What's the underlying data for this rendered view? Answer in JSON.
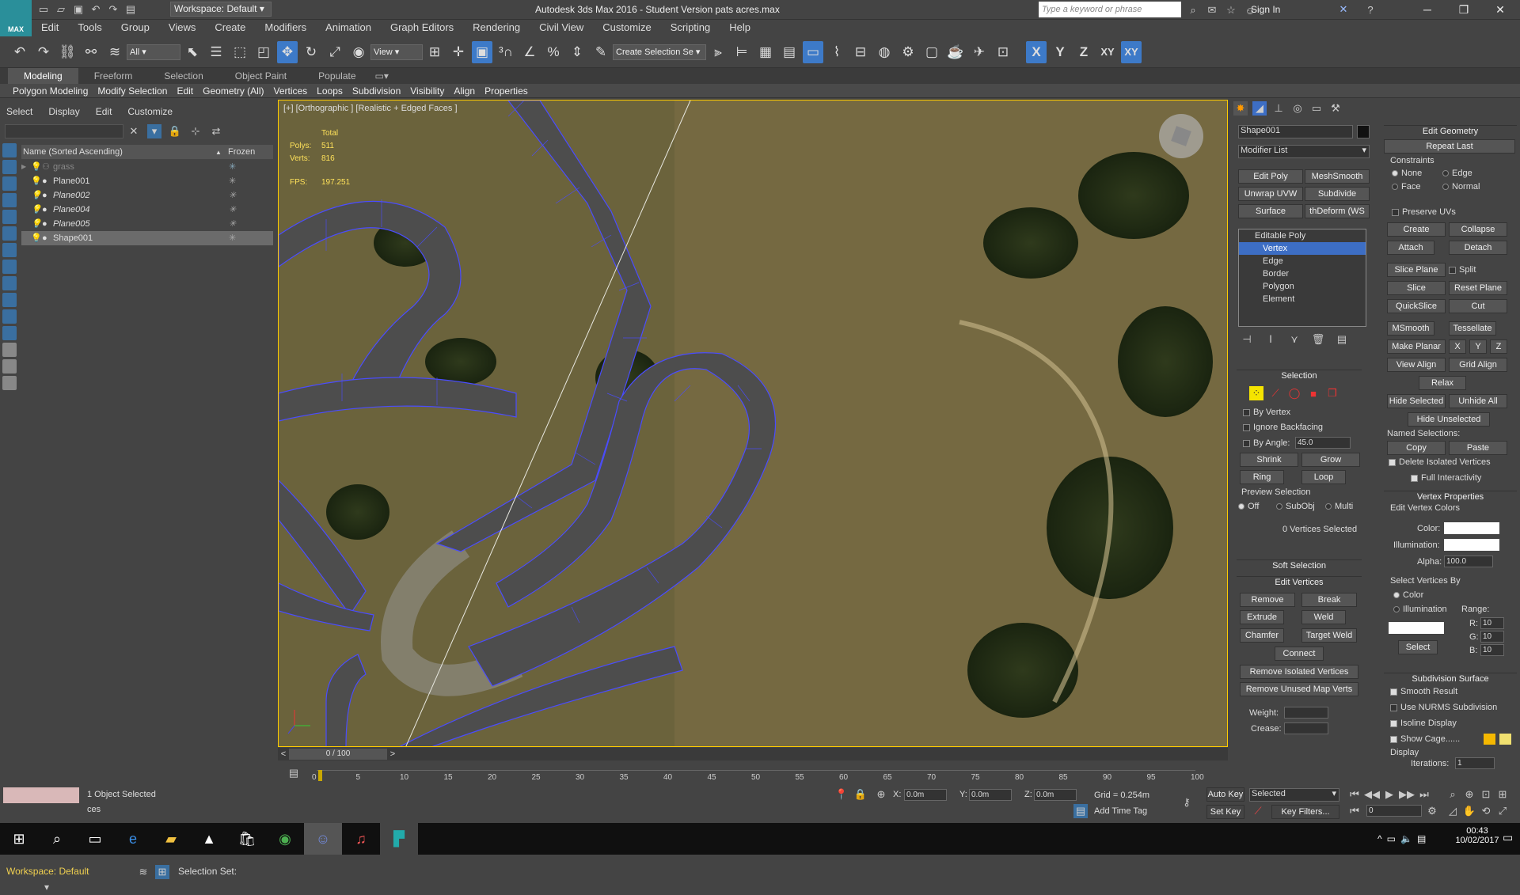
{
  "title_bar": {
    "workspace_label": "Workspace: Default",
    "window_title": "Autodesk 3ds Max 2016 - Student Version     pats acres.max",
    "search_placeholder": "Type a keyword or phrase",
    "sign_in": "Sign In",
    "logo_text": "MAX"
  },
  "menu": [
    "Edit",
    "Tools",
    "Group",
    "Views",
    "Create",
    "Modifiers",
    "Animation",
    "Graph Editors",
    "Rendering",
    "Civil View",
    "Customize",
    "Scripting",
    "Help"
  ],
  "main_toolbar": {
    "filter_value": "All",
    "coord_value": "View",
    "selection_set": "Create Selection Se",
    "axis_labels": [
      "X",
      "Y",
      "Z",
      "XY",
      "XY"
    ]
  },
  "ribbon_tabs": [
    "Modeling",
    "Freeform",
    "Selection",
    "Object Paint",
    "Populate"
  ],
  "ribbon_row2": [
    "Polygon Modeling",
    "Modify Selection",
    "Edit",
    "Geometry (All)",
    "Vertices",
    "Loops",
    "Subdivision",
    "Visibility",
    "Align",
    "Properties"
  ],
  "explorer": {
    "menu": [
      "Select",
      "Display",
      "Edit",
      "Customize"
    ],
    "col_name": "Name (Sorted Ascending)",
    "col_frozen": "Frozen",
    "rows": [
      {
        "name": "grass",
        "dim": true
      },
      {
        "name": "Plane001",
        "dim": false
      },
      {
        "name": "Plane002",
        "dim": false
      },
      {
        "name": "Plane004",
        "dim": false
      },
      {
        "name": "Plane005",
        "dim": false
      },
      {
        "name": "Shape001",
        "dim": false
      }
    ],
    "workspace": "Workspace: Default",
    "selection_set": "Selection Set:"
  },
  "viewport": {
    "label": "[+] [Orthographic ] [Realistic + Edged Faces ]",
    "stats_total": "Total",
    "polys_label": "Polys:",
    "polys_value": "511",
    "verts_label": "Verts:",
    "verts_value": "816",
    "fps_label": "FPS:",
    "fps_value": "197.251"
  },
  "timeline": {
    "frame": "0 / 100",
    "ticks": [
      "0",
      "5",
      "10",
      "15",
      "20",
      "25",
      "30",
      "35",
      "40",
      "45",
      "50",
      "55",
      "60",
      "65",
      "70",
      "75",
      "80",
      "85",
      "90",
      "95",
      "100"
    ]
  },
  "command_panel": {
    "object_name": "Shape001",
    "modifier_list": "Modifier List",
    "mod_buttons": [
      "Edit Poly",
      "MeshSmooth",
      "Unwrap UVW",
      "Subdivide",
      "Surface",
      "thDeform (WS"
    ],
    "stack": [
      "Editable Poly",
      "Vertex",
      "Edge",
      "Border",
      "Polygon",
      "Element"
    ],
    "selection": {
      "title": "Selection",
      "by_vertex": "By Vertex",
      "ignore_backfacing": "Ignore Backfacing",
      "by_angle": "By Angle:",
      "angle_value": "45.0",
      "shrink": "Shrink",
      "grow": "Grow",
      "ring": "Ring",
      "loop": "Loop",
      "preview": "Preview Selection",
      "off": "Off",
      "subobj": "SubObj",
      "multi": "Multi",
      "status": "0 Vertices Selected"
    },
    "soft_selection": "Soft Selection",
    "edit_vertices": {
      "title": "Edit Vertices",
      "buttons": [
        "Remove",
        "Break",
        "Extrude",
        "Weld",
        "Chamfer",
        "Target Weld",
        "Connect",
        "Remove Isolated Vertices",
        "Remove Unused Map Verts"
      ],
      "weight": "Weight:",
      "crease": "Crease:"
    },
    "edit_geometry": {
      "title": "Edit Geometry",
      "repeat_last": "Repeat Last",
      "constraints": "Constraints",
      "none": "None",
      "edge": "Edge",
      "face": "Face",
      "normal": "Normal",
      "preserve_uvs": "Preserve UVs",
      "create": "Create",
      "collapse": "Collapse",
      "attach": "Attach",
      "detach": "Detach",
      "slice_plane": "Slice Plane",
      "split": "Split",
      "slice": "Slice",
      "reset_plane": "Reset Plane",
      "quickslice": "QuickSlice",
      "cut": "Cut",
      "msmooth": "MSmooth",
      "tessellate": "Tessellate",
      "make_planar": "Make Planar",
      "xyz": [
        "X",
        "Y",
        "Z"
      ],
      "view_align": "View Align",
      "grid_align": "Grid Align",
      "relax": "Relax",
      "hide_selected": "Hide Selected",
      "unhide_all": "Unhide All",
      "hide_unselected": "Hide Unselected",
      "named_selections": "Named Selections:",
      "copy": "Copy",
      "paste": "Paste",
      "delete_isolated": "Delete Isolated Vertices",
      "full_interactivity": "Full Interactivity"
    },
    "vertex_properties": {
      "title": "Vertex Properties",
      "edit_colors": "Edit Vertex Colors",
      "color": "Color:",
      "illumination": "Illumination:",
      "alpha": "Alpha:",
      "alpha_value": "100.0",
      "select_by": "Select Vertices By",
      "by_color": "Color",
      "by_illum": "Illumination",
      "range": "Range:",
      "r": "R:",
      "g": "G:",
      "b": "B:",
      "range_value": "10",
      "select": "Select"
    },
    "subdivision": {
      "title": "Subdivision Surface",
      "smooth_result": "Smooth Result",
      "use_nurms": "Use NURMS Subdivision",
      "isoline": "Isoline Display",
      "show_cage": "Show Cage......",
      "display": "Display",
      "iterations": "Iterations:",
      "iterations_value": "1"
    }
  },
  "status_bar": {
    "objects_selected": "1 Object Selected",
    "x_label": "X:",
    "x_value": "0.0m",
    "y_label": "Y:",
    "y_value": "0.0m",
    "z_label": "Z:",
    "z_value": "0.0m",
    "grid": "Grid = 0.254m",
    "add_time_tag": "Add Time Tag",
    "auto_key": "Auto Key",
    "selected_dd": "Selected",
    "set_key": "Set Key",
    "key_filters": "Key Filters...",
    "frame_value": "0",
    "bottom_left": "ces"
  },
  "taskbar": {
    "time": "00:43",
    "date": "10/02/2017"
  },
  "colors": {
    "accent": "#3d6ec4",
    "viewport_border": "#ffcc00",
    "stats": "#ffe25a",
    "mesh_edge": "#4a4cff"
  }
}
